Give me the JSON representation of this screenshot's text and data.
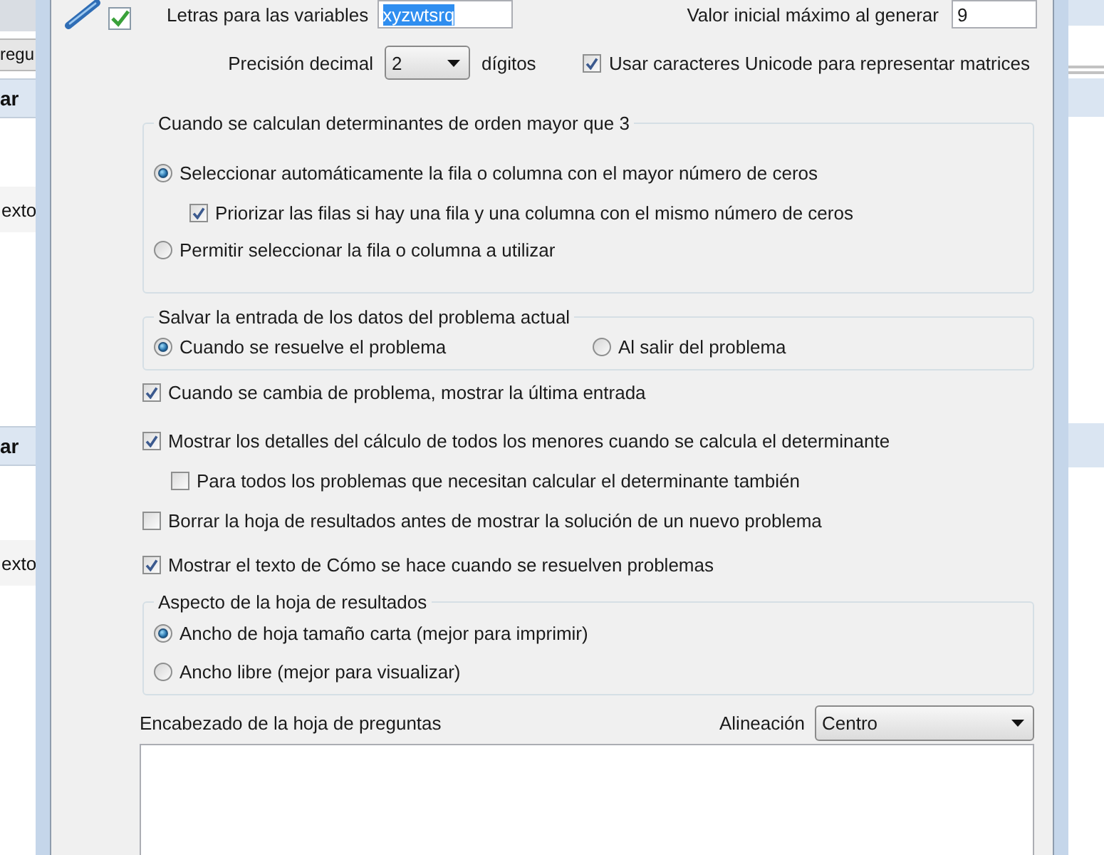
{
  "background_window": {
    "left_items": [
      {
        "kind": "field",
        "text": "regu"
      },
      {
        "kind": "header",
        "text": "ar"
      },
      {
        "kind": "cell",
        "text": "exto"
      },
      {
        "kind": "header",
        "text": "ar"
      },
      {
        "kind": "cell",
        "text": "exto"
      }
    ]
  },
  "dialog": {
    "top_fields": [
      {
        "label": "Letras para las variables",
        "value": "xyzwtsrq",
        "text_selected": true
      },
      {
        "label": "Valor inicial máximo al generar",
        "value": "9",
        "text_selected": false
      }
    ],
    "precision": {
      "label": "Precisión decimal",
      "value": "2",
      "unit": "dígitos"
    },
    "unicode_option": {
      "label": "Usar caracteres Unicode para representar matrices",
      "checked": true
    },
    "determinant_group": {
      "title": "Cuando se calculan determinantes de orden mayor que 3",
      "options": [
        {
          "label": "Seleccionar automáticamente la fila o columna con el mayor número de ceros",
          "selected": true,
          "children": [
            {
              "label": "Priorizar las filas si hay una fila y una columna con el mismo número de ceros",
              "checked": true
            }
          ]
        },
        {
          "label": "Permitir seleccionar la fila o columna a utilizar",
          "selected": false
        }
      ]
    },
    "save_input_group": {
      "title": "Salvar la entrada de los datos del problema actual",
      "options": [
        {
          "label": "Cuando se resuelve el problema",
          "selected": true
        },
        {
          "label": "Al salir del problema",
          "selected": false
        }
      ]
    },
    "options": [
      {
        "label": "Cuando se cambia de problema, mostrar la última entrada",
        "checked": true
      },
      {
        "label": "Mostrar los detalles del cálculo de todos los menores cuando se calcula el determinante",
        "checked": true,
        "children": [
          {
            "label": "Para todos los problemas que necesitan calcular el determinante también",
            "checked": false
          }
        ]
      },
      {
        "label": "Borrar la hoja de resultados antes de mostrar la solución de un nuevo problema",
        "checked": false
      },
      {
        "label": "Mostrar el texto de Cómo se hace cuando se resuelven problemas",
        "checked": true
      }
    ],
    "results_sheet_group": {
      "title": "Aspecto de la hoja de resultados",
      "options": [
        {
          "label": "Ancho de hoja tamaño carta (mejor para imprimir)",
          "selected": true
        },
        {
          "label": "Ancho libre (mejor para visualizar)",
          "selected": false
        }
      ]
    },
    "question_header": {
      "label": "Encabezado de la hoja de preguntas",
      "alignment_label": "Alineación",
      "alignment": "Centro"
    }
  }
}
